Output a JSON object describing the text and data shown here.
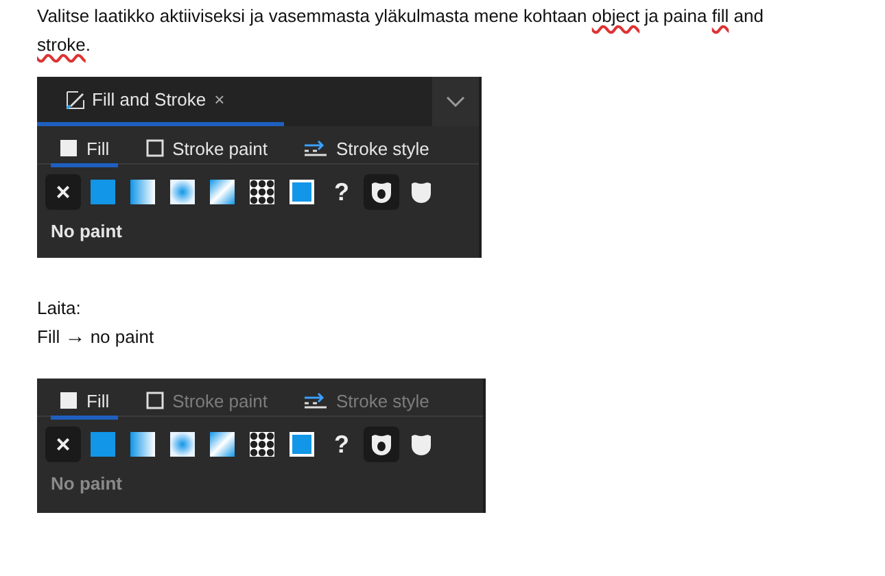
{
  "paragraphs": [
    {
      "segments": [
        {
          "text": "Valitse laatikko aktiiviseksi ja vasemmasta yläkulmasta mene kohtaan ",
          "misspelled": false
        },
        {
          "text": "object",
          "misspelled": true
        },
        {
          "text": " ja paina ",
          "misspelled": false
        },
        {
          "text": "fill",
          "misspelled": true
        },
        {
          "text": " and ",
          "misspelled": false
        },
        {
          "text": "stroke",
          "misspelled": true
        },
        {
          "text": ".",
          "misspelled": false
        }
      ]
    }
  ],
  "panels": [
    {
      "dialog_tab": {
        "label": "Fill and Stroke",
        "close": "×"
      },
      "dimmed": false,
      "subtabs": [
        {
          "label": "Fill",
          "kind": "fill",
          "selected": true
        },
        {
          "label": "Stroke paint",
          "kind": "stroke",
          "selected": false
        },
        {
          "label": "Stroke style",
          "kind": "style",
          "selected": false
        }
      ],
      "paint_buttons": [
        {
          "kind": "none",
          "label": "×",
          "selected": true
        },
        {
          "kind": "flat",
          "selected": false
        },
        {
          "kind": "linear",
          "selected": false
        },
        {
          "kind": "radial",
          "selected": false
        },
        {
          "kind": "mesh",
          "selected": false
        },
        {
          "kind": "pattern",
          "selected": false
        },
        {
          "kind": "swatch",
          "selected": false
        },
        {
          "kind": "unset",
          "label": "?",
          "selected": false
        },
        {
          "kind": "evenodd",
          "selected": true
        },
        {
          "kind": "nonzero",
          "selected": false
        }
      ],
      "status": "No paint"
    },
    {
      "dimmed": true,
      "subtabs": [
        {
          "label": "Fill",
          "kind": "fill",
          "selected": true
        },
        {
          "label": "Stroke paint",
          "kind": "stroke",
          "selected": false
        },
        {
          "label": "Stroke style",
          "kind": "style",
          "selected": false
        }
      ],
      "paint_buttons": [
        {
          "kind": "none",
          "label": "×",
          "selected": true
        },
        {
          "kind": "flat",
          "selected": false
        },
        {
          "kind": "linear",
          "selected": false
        },
        {
          "kind": "radial",
          "selected": false
        },
        {
          "kind": "mesh",
          "selected": false
        },
        {
          "kind": "pattern",
          "selected": false
        },
        {
          "kind": "swatch",
          "selected": false
        },
        {
          "kind": "unset",
          "label": "?",
          "selected": false
        },
        {
          "kind": "evenodd",
          "selected": true
        },
        {
          "kind": "nonzero",
          "selected": false
        }
      ],
      "status": "No paint"
    }
  ],
  "instructions": {
    "heading": "Laita:",
    "step_from": "Fill",
    "arrow": "→",
    "step_to": "no paint"
  }
}
